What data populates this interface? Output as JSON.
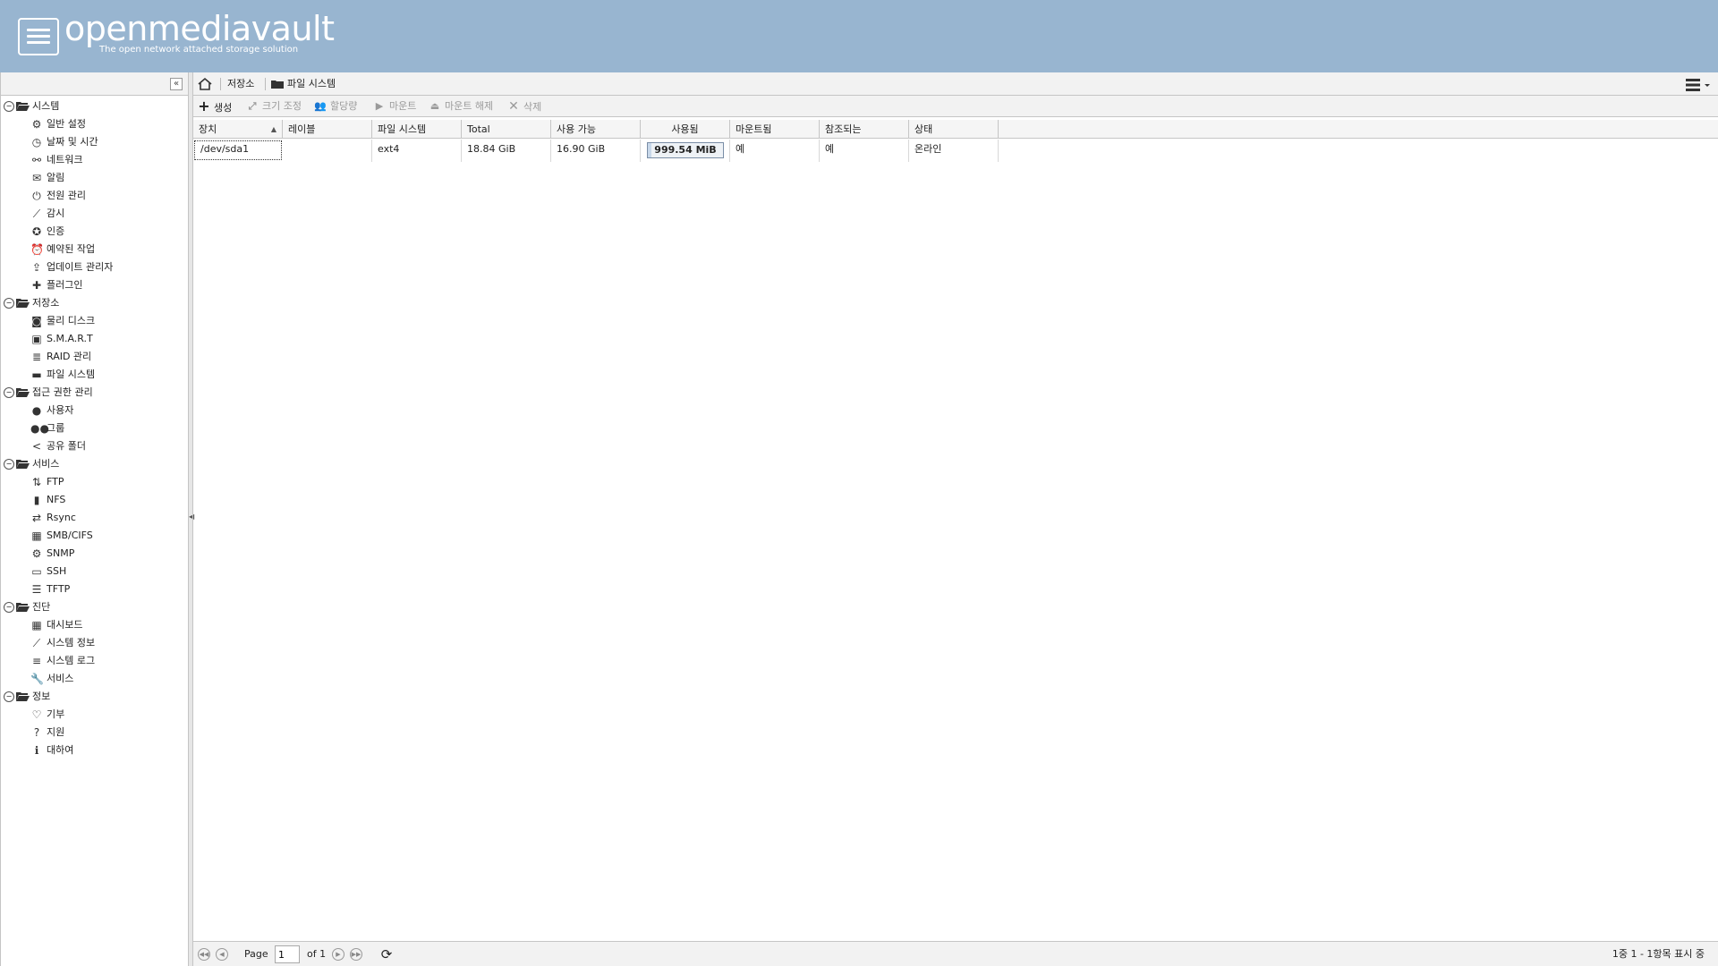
{
  "app": {
    "title": "openmediavault",
    "subtitle": "The open network attached storage solution"
  },
  "colors": {
    "header_bg": "#98b5d0",
    "panel_bg": "#f2f2f2",
    "border": "#c5c5c5"
  },
  "sidebar": {
    "groups": [
      {
        "label": "시스템",
        "items": [
          {
            "label": "일반 설정",
            "icon": "gears-icon"
          },
          {
            "label": "날짜 및 시간",
            "icon": "clock-icon"
          },
          {
            "label": "네트워크",
            "icon": "network-icon"
          },
          {
            "label": "알림",
            "icon": "envelope-icon"
          },
          {
            "label": "전원 관리",
            "icon": "power-icon"
          },
          {
            "label": "감시",
            "icon": "chart-line-icon"
          },
          {
            "label": "인증",
            "icon": "certificate-icon"
          },
          {
            "label": "예약된 작업",
            "icon": "alarm-clock-icon"
          },
          {
            "label": "업데이트 관리자",
            "icon": "update-icon"
          },
          {
            "label": "플러그인",
            "icon": "puzzle-icon"
          }
        ]
      },
      {
        "label": "저장소",
        "items": [
          {
            "label": "물리 디스크",
            "icon": "disk-icon"
          },
          {
            "label": "S.M.A.R.T",
            "icon": "smart-icon"
          },
          {
            "label": "RAID 관리",
            "icon": "database-icon"
          },
          {
            "label": "파일 시스템",
            "icon": "folder-icon"
          }
        ]
      },
      {
        "label": "접근 권한 관리",
        "items": [
          {
            "label": "사용자",
            "icon": "user-icon"
          },
          {
            "label": "그룹",
            "icon": "users-icon"
          },
          {
            "label": "공유 폴더",
            "icon": "share-icon"
          }
        ]
      },
      {
        "label": "서비스",
        "items": [
          {
            "label": "FTP",
            "icon": "ftp-icon"
          },
          {
            "label": "NFS",
            "icon": "nfs-icon"
          },
          {
            "label": "Rsync",
            "icon": "rsync-icon"
          },
          {
            "label": "SMB/CIFS",
            "icon": "windows-icon"
          },
          {
            "label": "SNMP",
            "icon": "snmp-icon"
          },
          {
            "label": "SSH",
            "icon": "terminal-icon"
          },
          {
            "label": "TFTP",
            "icon": "tftp-icon"
          }
        ]
      },
      {
        "label": "진단",
        "items": [
          {
            "label": "대시보드",
            "icon": "dashboard-icon"
          },
          {
            "label": "시스템 정보",
            "icon": "chart-line-icon"
          },
          {
            "label": "시스템 로그",
            "icon": "log-icon"
          },
          {
            "label": "서비스",
            "icon": "wrench-icon"
          }
        ]
      },
      {
        "label": "정보",
        "items": [
          {
            "label": "기부",
            "icon": "heart-icon"
          },
          {
            "label": "지원",
            "icon": "question-icon"
          },
          {
            "label": "대하여",
            "icon": "info-icon"
          }
        ]
      }
    ]
  },
  "breadcrumb": {
    "storage": "저장소",
    "filesystems": "파일 시스템"
  },
  "toolbar": {
    "create": "생성",
    "resize": "크기 조정",
    "quota": "할당량",
    "mount": "마운트",
    "unmount": "마운트 해제",
    "delete": "삭제"
  },
  "grid": {
    "columns": [
      "장치",
      "레이블",
      "파일 시스템",
      "Total",
      "사용 가능",
      "사용됨",
      "마운트됨",
      "참조되는",
      "상태"
    ],
    "rows": [
      {
        "device": "/dev/sda1",
        "label": "",
        "filesystem": "ext4",
        "total": "18.84 GiB",
        "available": "16.90 GiB",
        "used": "999.54 MiB",
        "used_fraction": 0.05,
        "mounted": "예",
        "referenced": "예",
        "status": "온라인"
      }
    ]
  },
  "paging": {
    "page_label": "Page",
    "page_value": "1",
    "of_label": "of 1",
    "status": "1중 1 - 1항목 표시 중"
  }
}
